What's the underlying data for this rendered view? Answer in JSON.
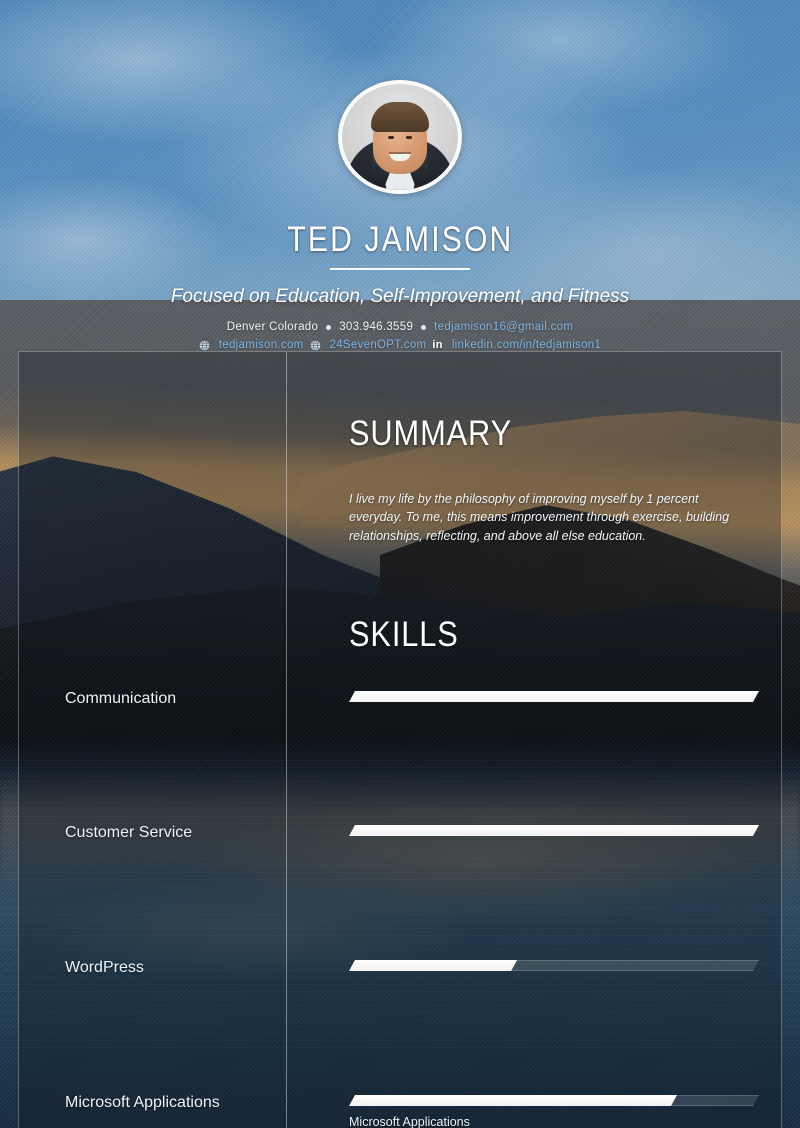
{
  "header": {
    "name": "TED JAMISON",
    "tagline": "Focused on Education, Self-Improvement, and Fitness",
    "contact_line_1": {
      "location": "Denver Colorado",
      "phone": "303.946.3559",
      "email": "tedjamison16@gmail.com"
    },
    "contact_line_2": {
      "website_1": "tedjamison.com",
      "website_2": "24SevenOPT.com",
      "linkedin": "linkedin.com/in/tedjamison1",
      "linkedin_mark": "in"
    },
    "avatar_alt": "profile-photo"
  },
  "summary": {
    "title": "SUMMARY",
    "text": "I live my life by the philosophy of improving myself by 1 percent everyday. To me, this means improvement through exercise, building relationships, reflecting, and above all else education."
  },
  "skills": {
    "title": "SKILLS",
    "items": [
      {
        "label": "Communication",
        "level": 100
      },
      {
        "label": "Customer Service",
        "level": 100
      },
      {
        "label": "WordPress",
        "level": 41
      },
      {
        "label": "Microsoft Applications",
        "level": 80
      }
    ],
    "trailing_label": "Microsoft Applications"
  },
  "colors": {
    "accent_link": "#7fb4e0",
    "text_primary": "#ffffff",
    "bar_fill": "#ffffff",
    "panel_border": "rgba(255,255,255,0.30)"
  }
}
